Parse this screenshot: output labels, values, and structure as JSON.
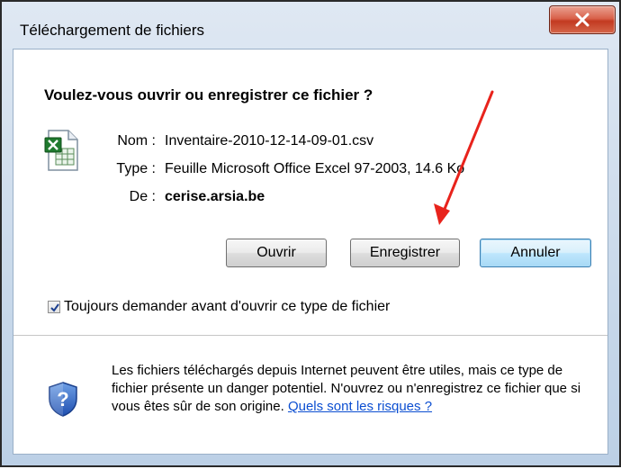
{
  "window": {
    "title": "Téléchargement de fichiers",
    "close_icon": "close-x-icon"
  },
  "dialog": {
    "question": "Voulez-vous ouvrir ou enregistrer ce fichier ?",
    "file_icon": "excel-csv-file-icon",
    "name_label": "Nom :",
    "name_value": "Inventaire-2010-12-14-09-01.csv",
    "type_label": "Type :",
    "type_value": "Feuille Microsoft Office Excel 97-2003, 14.6 Ko",
    "from_label": "De :",
    "from_value": "cerise.arsia.be"
  },
  "buttons": {
    "open": "Ouvrir",
    "save": "Enregistrer",
    "cancel": "Annuler"
  },
  "checkbox": {
    "label": "Toujours demander avant d'ouvrir ce type de fichier",
    "checked": true
  },
  "warning": {
    "icon": "shield-question-icon",
    "text": "Les fichiers téléchargés depuis Internet peuvent être utiles, mais ce type de fichier présente un danger potentiel. N'ouvrez ou n'enregistrez ce fichier que si vous êtes sûr de son origine.",
    "link_text": "Quels sont les risques ?"
  },
  "annotation": {
    "type": "red-arrow",
    "color": "#e8231c"
  },
  "colors": {
    "close_button": "#c23a21",
    "link": "#0b4ed1",
    "default_button_border": "#3c7fb1"
  }
}
